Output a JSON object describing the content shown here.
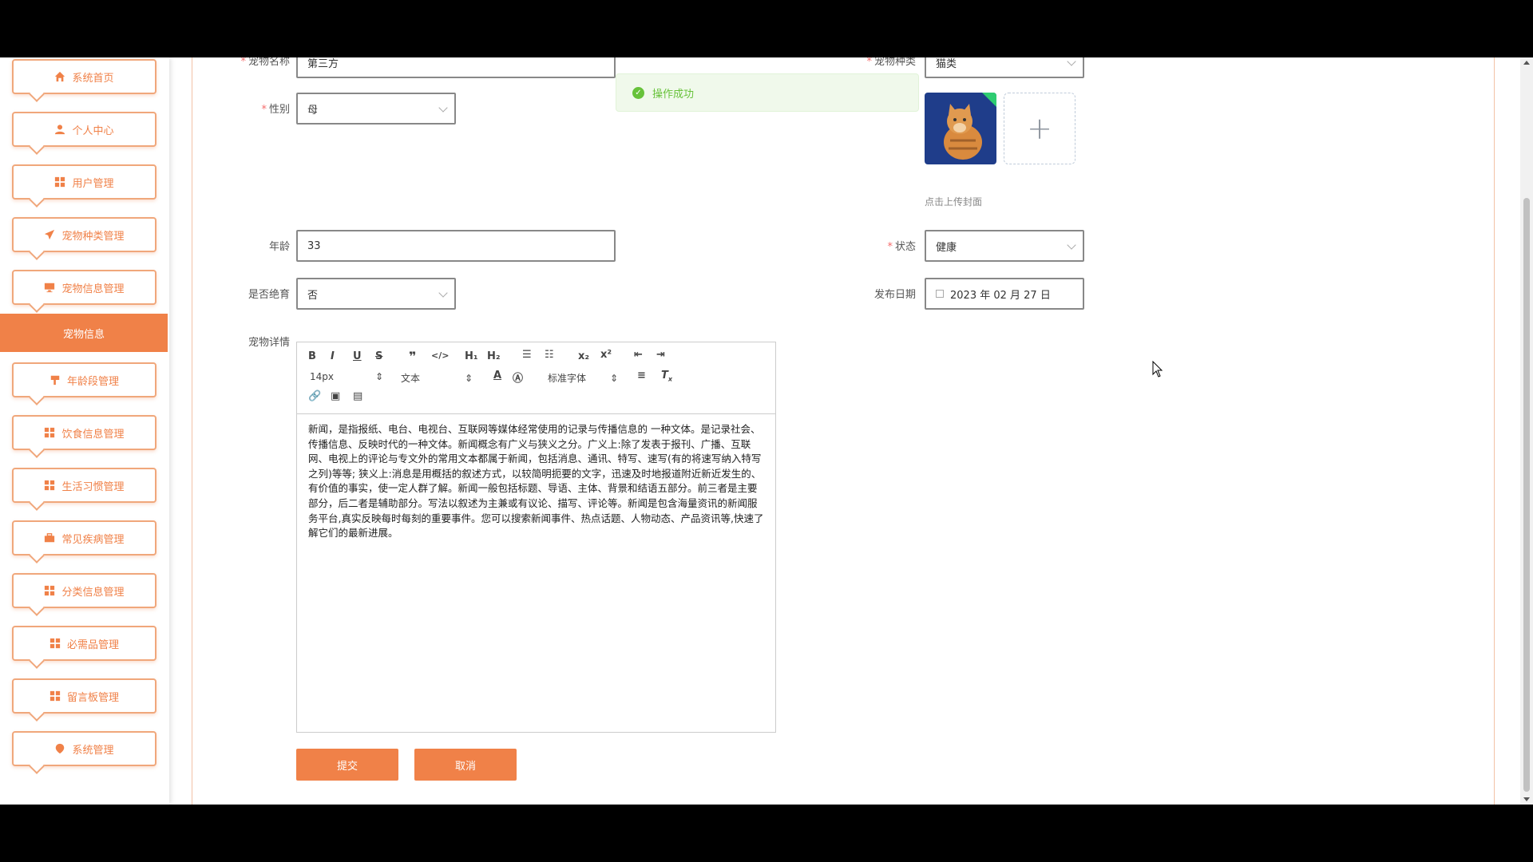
{
  "sidebar": {
    "items": [
      {
        "label": "系统首页",
        "icon": "home-icon"
      },
      {
        "label": "个人中心",
        "icon": "user-icon"
      },
      {
        "label": "用户管理",
        "icon": "grid-icon"
      },
      {
        "label": "宠物种类管理",
        "icon": "send-icon"
      },
      {
        "label": "宠物信息管理",
        "icon": "monitor-icon"
      },
      {
        "label": "年龄段管理",
        "icon": "flag-icon"
      },
      {
        "label": "饮食信息管理",
        "icon": "grid-icon"
      },
      {
        "label": "生活习惯管理",
        "icon": "grid-icon"
      },
      {
        "label": "常见疾病管理",
        "icon": "briefcase-icon"
      },
      {
        "label": "分类信息管理",
        "icon": "grid-icon"
      },
      {
        "label": "必需品管理",
        "icon": "grid-icon"
      },
      {
        "label": "留言板管理",
        "icon": "grid-icon"
      },
      {
        "label": "系统管理",
        "icon": "location-icon"
      }
    ],
    "active_sub": "宠物信息"
  },
  "form": {
    "pet_name_label": "宠物名称",
    "pet_name_value": "第三方",
    "pet_type_label": "宠物种类",
    "pet_type_value": "猫类",
    "gender_label": "性别",
    "gender_value": "母",
    "age_label": "年龄",
    "age_value": "33",
    "status_label": "状态",
    "status_value": "健康",
    "sterilized_label": "是否绝育",
    "sterilized_value": "否",
    "publish_date_label": "发布日期",
    "publish_date_value": "2023 年 02 月 27 日",
    "detail_label": "宠物详情",
    "upload_hint": "点击上传封面",
    "upload_plus": "+"
  },
  "toast": {
    "message": "操作成功"
  },
  "editor": {
    "font_size": "14px",
    "text_type": "文本",
    "font_family": "标准字体",
    "content": "新闻，是指报纸、电台、电视台、互联网等媒体经常使用的记录与传播信息的 一种文体。是记录社会、传播信息、反映时代的一种文体。新闻概念有广义与狭义之分。广义上:除了发表于报刊、广播、互联网、电视上的评论与专文外的常用文本都属于新闻，包括消息、通讯、特写、速写(有的将速写纳入特写之列)等等; 狭义上:消息是用概括的叙述方式，以较简明扼要的文字，迅速及时地报道附近新近发生的、有价值的事实，使一定人群了解。新闻一般包括标题、导语、主体、背景和结语五部分。前三者是主要部分，后二者是辅助部分。写法以叙述为主兼或有议论、描写、评论等。新闻是包含海量资讯的新闻服务平台,真实反映每时每刻的重要事件。您可以搜索新闻事件、热点话题、人物动态、产品资讯等,快速了解它们的最新进展。"
  },
  "buttons": {
    "submit": "提交",
    "cancel": "取消"
  },
  "colors": {
    "accent": "#f08148",
    "success": "#67c23a"
  }
}
